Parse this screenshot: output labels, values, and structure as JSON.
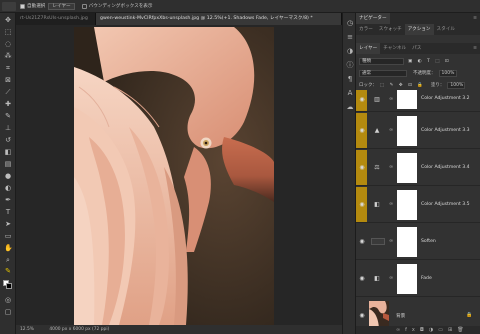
{
  "options_bar": {
    "auto_select_label": "自動選択",
    "auto_select_target": "レイヤー",
    "show_transform_label": "バウンディングボックスを表示"
  },
  "tabs": [
    {
      "label": "rt-Us21Z7RsUIs-unsplash.jpg"
    },
    {
      "label": "gwen-weustink-MvCIRfpxXbs-unsplash.jpg @ 12.5%(+1. Shadows Fade, レイヤーマスク/8) *"
    }
  ],
  "status": {
    "zoom": "12.5%",
    "doc_size": "4000 px x 6000 px (72 ppi)"
  },
  "panels": {
    "top_tabs": [
      "ナビゲーター"
    ],
    "mid_tabs": [
      "カラー",
      "スウォッチ",
      "アクション",
      "スタイル"
    ],
    "mid_active": "アクション",
    "layer_tabs": [
      "レイヤー",
      "チャンネル",
      "パス"
    ],
    "kind_label": "種類",
    "blend_mode": "通常",
    "opacity_label": "不透明度：",
    "opacity_value": "100%",
    "lock_label": "ロック：",
    "fill_label": "塗り：",
    "fill_value": "100%"
  },
  "layers": [
    {
      "name": "Color Adjustment 3.2",
      "tagged": true
    },
    {
      "name": "Color Adjustment 3.3",
      "tagged": true
    },
    {
      "name": "Color Adjustment 3.4",
      "tagged": true
    },
    {
      "name": "Color Adjustment 3.5",
      "tagged": true
    },
    {
      "name": "Soften",
      "tagged": false
    },
    {
      "name": "Fade",
      "tagged": false
    },
    {
      "name": "背景",
      "tagged": false
    }
  ],
  "colors": {
    "tag": "#b48a0f",
    "canvas_bg": "#3a2e23"
  }
}
